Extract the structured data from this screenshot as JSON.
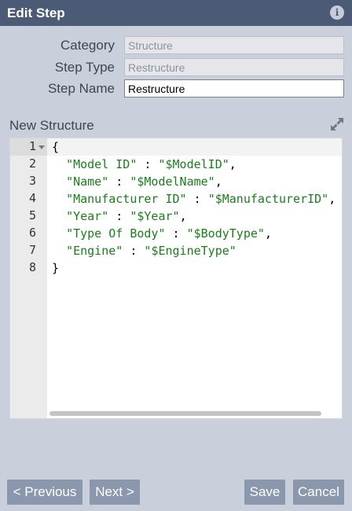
{
  "dialog": {
    "title": "Edit Step",
    "info_icon": "info-icon"
  },
  "form": {
    "category": {
      "label": "Category",
      "value": "Structure"
    },
    "step_type": {
      "label": "Step Type",
      "value": "Restructure"
    },
    "step_name": {
      "label": "Step Name",
      "value": "Restructure"
    }
  },
  "editor": {
    "section_title": "New Structure",
    "expand_icon": "expand-icon",
    "line_numbers": [
      "1",
      "2",
      "3",
      "4",
      "5",
      "6",
      "7",
      "8"
    ],
    "lines": [
      [
        "{"
      ],
      [
        "  ",
        "\"Model ID\"",
        " : ",
        "\"$ModelID\"",
        ","
      ],
      [
        "  ",
        "\"Name\"",
        " : ",
        "\"$ModelName\"",
        ","
      ],
      [
        "  ",
        "\"Manufacturer ID\"",
        " : ",
        "\"$ManufacturerID\"",
        ","
      ],
      [
        "  ",
        "\"Year\"",
        " : ",
        "\"$Year\"",
        ","
      ],
      [
        "  ",
        "\"Type Of Body\"",
        " : ",
        "\"$BodyType\"",
        ","
      ],
      [
        "  ",
        "\"Engine\"",
        " : ",
        "\"$EngineType\""
      ],
      [
        "}"
      ]
    ]
  },
  "buttons": {
    "previous": "< Previous",
    "next": "Next >",
    "save": "Save",
    "cancel": "Cancel"
  },
  "colors": {
    "title_bar": "#4b5a75",
    "background": "#c9cfdb",
    "button": "#8a97ad",
    "string": "#1a7f1a"
  }
}
